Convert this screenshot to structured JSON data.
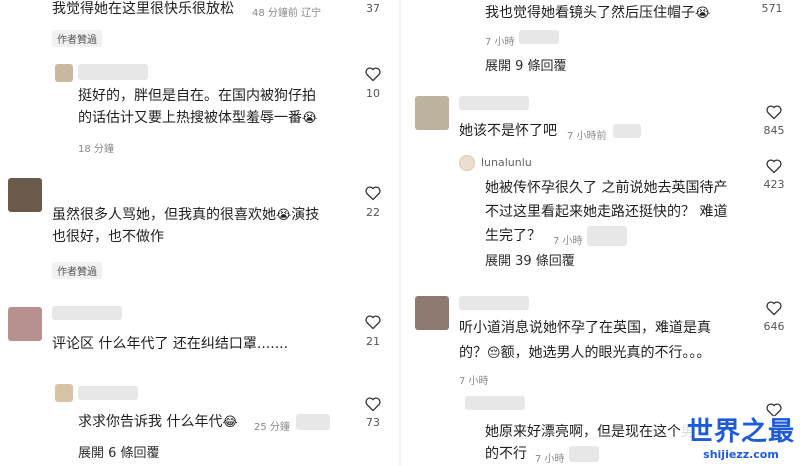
{
  "left": {
    "c1": {
      "text": "我觉得她在这里很快乐很放松",
      "time": "48 分鐘前  辽宁",
      "likes": "37",
      "badge": "作者贊過"
    },
    "c2": {
      "line1": "挺好的，胖但是自在。在国内被狗仔拍",
      "line2": "的话估计又要上热搜被体型羞辱一番",
      "emoji": "😭",
      "time": "18 分鐘",
      "likes": "10"
    },
    "c3": {
      "line1": "虽然很多人骂她，但我真的很喜欢她",
      "emoji": "😭",
      "line1b": "演技",
      "line2": "也很好，也不做作",
      "badge": "作者贊過",
      "likes": "22"
    },
    "c4": {
      "text": "评论区 什么年代了 还在纠结口罩.......",
      "likes": "21"
    },
    "c5": {
      "text": "求求你告诉我 什么年代",
      "emoji": "😂",
      "time": "25 分鐘",
      "likes": "73",
      "replies": "展開 6 條回覆"
    }
  },
  "right": {
    "c1": {
      "text": "我也觉得她看镜头了然后压住帽子",
      "emoji": "😭",
      "time": "7 小時",
      "likes": "571",
      "replies": "展開 9 條回覆"
    },
    "c2": {
      "text": "她该不是怀了吧",
      "time": "7 小時前",
      "likes": "845"
    },
    "c3": {
      "username": "lunalunlu",
      "line1": "她被传怀孕很久了 之前说她去英国待产",
      "line2": "不过这里看起来她走路还挺快的？ 难道",
      "line3": "生完了？",
      "time": "7 小時",
      "likes": "423",
      "replies": "展開 39 條回覆"
    },
    "c4": {
      "line1": "听小道消息说她怀孕了在英国，难道是真",
      "line2a": "的？",
      "emoji": "😔",
      "line2b": "额，她选男人的眼光真的不行。。。",
      "time": "7 小時",
      "likes": "646"
    },
    "c5": {
      "line1": "她原来好漂亮啊，但是现在这个男",
      "line2": "的不行",
      "time": "7 小時"
    }
  },
  "watermark": {
    "title": "世界之最",
    "url": "shijiezz.com"
  },
  "icons": {
    "like": "heart-icon",
    "user": "user-icon"
  },
  "colors": {
    "accent": "#1e5bd8",
    "text": "#1f1f1f",
    "meta": "#8a8a8a"
  }
}
